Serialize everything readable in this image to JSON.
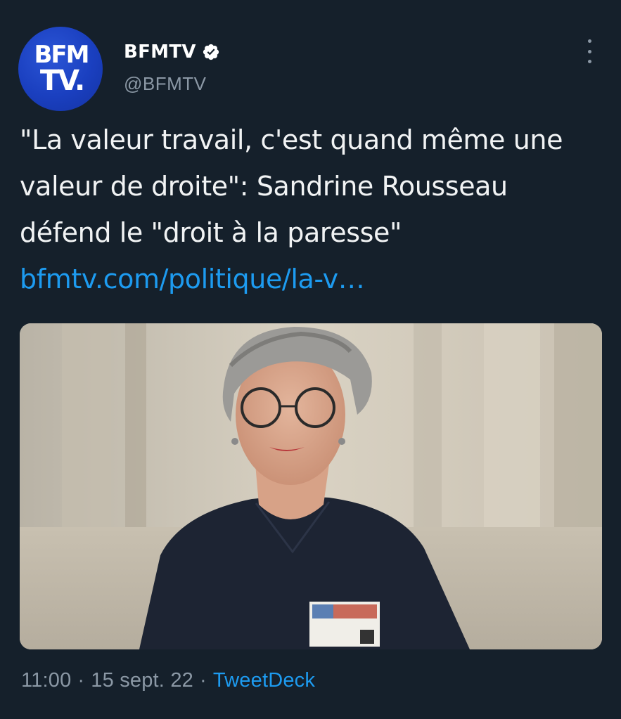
{
  "account": {
    "avatar_line1": "BFM",
    "avatar_line2": "TV.",
    "display_name": "BFMTV",
    "handle": "@BFMTV",
    "verified": true
  },
  "tweet": {
    "text": "\"La valeur travail, c'est quand même une valeur de droite\": Sandrine Rousseau défend le \"droit à la paresse\" ",
    "link_text": "bfmtv.com/politique/la-v…"
  },
  "meta": {
    "time": "11:00",
    "date": "15 sept. 22",
    "separator": "·",
    "source": "TweetDeck"
  },
  "colors": {
    "background": "#15202b",
    "link": "#1d9bf0",
    "secondary_text": "#8b98a5",
    "avatar_blue": "#1a3fbf"
  },
  "icons": {
    "verified": "verified-badge-icon",
    "more": "more-options-icon"
  }
}
